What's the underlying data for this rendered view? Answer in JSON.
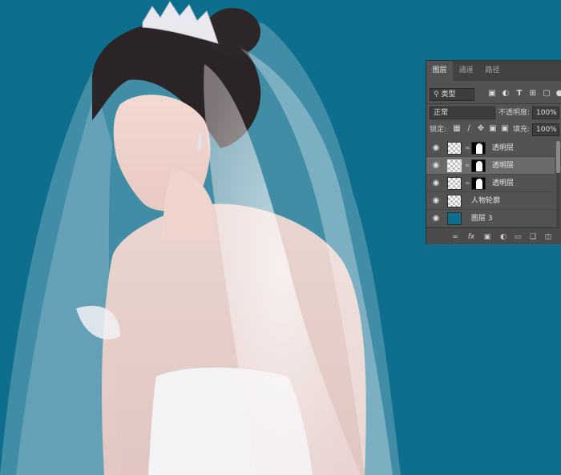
{
  "canvas": {
    "background_color": "#0d6e8e",
    "subject": "bride-with-veil-and-tiara"
  },
  "layers_panel": {
    "tabs": [
      {
        "label": "图层",
        "active": true
      },
      {
        "label": "通道",
        "active": false
      },
      {
        "label": "路径",
        "active": false
      }
    ],
    "filter": {
      "kind_label": "类型",
      "icons": [
        "search-icon",
        "image-filter-icon",
        "adjustment-filter-icon",
        "type-filter-icon",
        "shape-filter-icon",
        "smart-object-filter-icon"
      ]
    },
    "blend_mode": "正常",
    "opacity_label": "不透明度:",
    "opacity_value": "100%",
    "lock_label": "锁定:",
    "fill_label": "填充:",
    "fill_value": "100%",
    "layers": [
      {
        "name": "透明层",
        "has_mask": true,
        "selected": false,
        "visible": true
      },
      {
        "name": "透明层",
        "has_mask": true,
        "selected": true,
        "visible": true
      },
      {
        "name": "透明层",
        "has_mask": true,
        "selected": false,
        "visible": true
      },
      {
        "name": "人物轮廓",
        "has_mask": false,
        "selected": false,
        "visible": true
      },
      {
        "name": "图层 3",
        "has_mask": false,
        "selected": false,
        "visible": true,
        "thumb_color": "#0d6e8e"
      }
    ],
    "bottom_icons": [
      "link-icon",
      "fx-icon",
      "add-mask-icon",
      "adjustment-icon",
      "group-icon",
      "new-layer-icon",
      "delete-icon"
    ],
    "bottom_fx_label": "fx"
  }
}
